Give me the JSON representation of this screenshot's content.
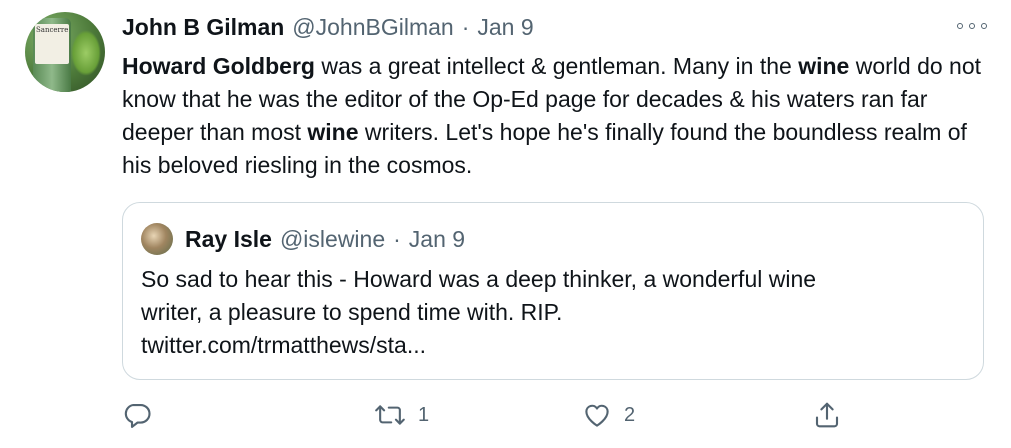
{
  "tweet": {
    "author_name": "John B Gilman",
    "author_handle": "@JohnBGilman",
    "separator": "·",
    "date": "Jan 9",
    "avatar_label": "Sancerre",
    "text_segments": [
      {
        "text": "Howard Goldberg",
        "bold": true
      },
      {
        "text": " was a great intellect & gentleman. Many in the ",
        "bold": false
      },
      {
        "text": "wine",
        "bold": true
      },
      {
        "text": " world do not know that he was the editor of the Op-Ed page for decades & his waters ran far deeper than most ",
        "bold": false
      },
      {
        "text": "wine",
        "bold": true
      },
      {
        "text": " writers. Let's hope he's finally found the boundless realm of his beloved riesling in the cosmos.",
        "bold": false
      }
    ]
  },
  "quote": {
    "author_name": "Ray Isle",
    "author_handle": "@islewine",
    "separator": "·",
    "date": "Jan 9",
    "text_line1": "So sad to hear this - Howard was a deep thinker, a wonderful wine",
    "text_line2": "writer, a pleasure to spend time with. RIP.",
    "link": "twitter.com/trmatthews/sta..."
  },
  "actions": {
    "reply_icon": "reply-icon",
    "retweet_icon": "retweet-icon",
    "retweet_count": "1",
    "like_icon": "like-icon",
    "like_count": "2",
    "share_icon": "share-icon"
  },
  "colors": {
    "text": "#0f1419",
    "secondary": "#536471",
    "border": "#cfd9de"
  }
}
